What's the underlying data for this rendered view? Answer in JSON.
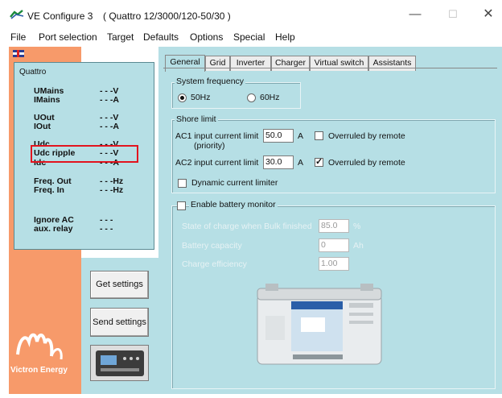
{
  "window": {
    "app_title": "VE Configure 3",
    "device_title": "( Quattro 12/3000/120-50/30 )",
    "minimize": "—",
    "maximize": "☐",
    "close": "✕"
  },
  "menu": [
    "File",
    "Port selection",
    "Target",
    "Defaults",
    "Options",
    "Special",
    "Help"
  ],
  "status_panel": {
    "device": "Quattro",
    "rows": [
      {
        "label": "UMains",
        "value": "- - -V"
      },
      {
        "label": "IMains",
        "value": "- - -A"
      },
      {
        "label": "UOut",
        "value": "- - -V"
      },
      {
        "label": "IOut",
        "value": "- - -A"
      },
      {
        "label": "Udc",
        "value": "- - -V"
      },
      {
        "label": "Udc ripple",
        "value": "- - -V"
      },
      {
        "label": "Idc",
        "value": "- - -A"
      },
      {
        "label": "Freq. Out",
        "value": "- - -Hz"
      },
      {
        "label": "Freq. In",
        "value": "- - -Hz"
      },
      {
        "label": "Ignore AC",
        "value": "- - -"
      },
      {
        "label": "aux. relay",
        "value": "- - -"
      }
    ],
    "highlight_color": "#e2141e"
  },
  "buttons": {
    "get_settings": "Get settings",
    "send_settings": "Send settings"
  },
  "brand": {
    "name": "Victron Energy"
  },
  "tabs": [
    "General",
    "Grid",
    "Inverter",
    "Charger",
    "Virtual switch",
    "Assistants"
  ],
  "active_tab": "General",
  "general": {
    "system_frequency": {
      "title": "System frequency",
      "options": [
        "50Hz",
        "60Hz"
      ],
      "selected": "50Hz"
    },
    "shore_limit": {
      "title": "Shore limit",
      "ac1_label": "AC1 input current limit",
      "ac1_sub": "(priority)",
      "ac1_value": "50.0",
      "ac1_unit": "A",
      "ac1_override_label": "Overruled by remote",
      "ac1_override_checked": false,
      "ac2_label": "AC2 input current limit",
      "ac2_value": "30.0",
      "ac2_unit": "A",
      "ac2_override_label": "Overruled by remote",
      "ac2_override_checked": true,
      "dynamic_label": "Dynamic current limiter",
      "dynamic_checked": false
    },
    "battery_monitor": {
      "title": "Enable battery monitor",
      "enabled": false,
      "soc_label": "State of charge when Bulk finished",
      "soc_value": "85.0",
      "soc_unit": "%",
      "capacity_label": "Battery capacity",
      "capacity_value": "0",
      "capacity_unit": "Ah",
      "efficiency_label": "Charge efficiency",
      "efficiency_value": "1.00"
    }
  },
  "colors": {
    "panel_bg": "#b6dfe5",
    "brand_orange": "#f79a6a"
  }
}
